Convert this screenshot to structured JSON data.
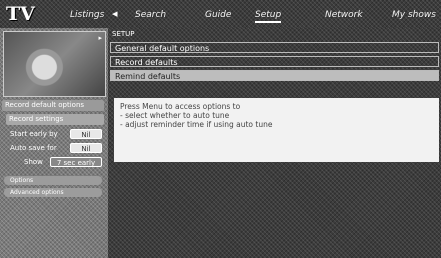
{
  "app": {
    "logo": "TV"
  },
  "tabs": [
    "Listings",
    "Search",
    "Guide",
    "Setup",
    "Network",
    "My shows"
  ],
  "active_tab_index": 3,
  "left_panel": {
    "thumbnail_label": "▸",
    "section_label": "Record default options",
    "subsection_label": "Record settings",
    "rows": [
      {
        "label": "Start early by",
        "value": "Nil"
      },
      {
        "label": "Auto save for",
        "value": "Nil"
      },
      {
        "label": "Show",
        "value": "7 sec early"
      }
    ],
    "pill_1": "Options",
    "pill_2": "Advanced options"
  },
  "main": {
    "breadcrumb": "SETUP",
    "options": [
      "General default options",
      "Record defaults",
      "Remind defaults"
    ],
    "selected_option_index": 2,
    "help_lines": [
      "Press Menu to access options to",
      "- select whether to auto tune",
      "- adjust reminder time if using auto tune"
    ]
  }
}
